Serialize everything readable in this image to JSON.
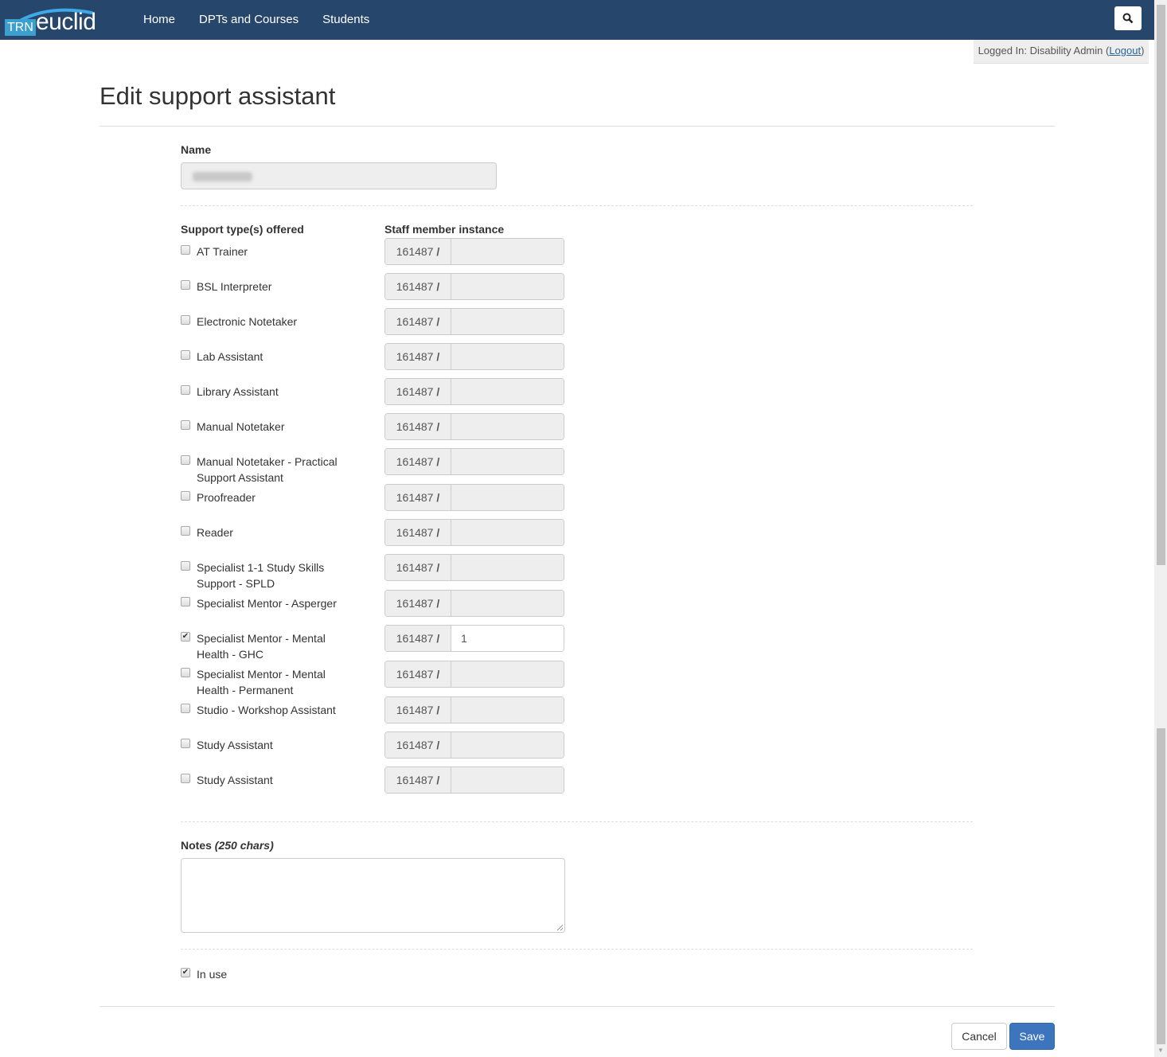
{
  "app": {
    "logo_prefix": "TRN",
    "logo_word": "euclid"
  },
  "nav": {
    "items": [
      {
        "label": "Home"
      },
      {
        "label": "DPTs and Courses"
      },
      {
        "label": "Students"
      }
    ],
    "search_icon": "search-icon"
  },
  "login": {
    "prefix": "Logged In: Disability Admin (",
    "logout_label": "Logout",
    "suffix": ")"
  },
  "page": {
    "title": "Edit support assistant"
  },
  "form": {
    "name_label": "Name",
    "name_value_redacted": true,
    "support_types_label": "Support type(s) offered",
    "staff_instance_label": "Staff member instance",
    "instance_prefix": "161487",
    "instance_separator": "/",
    "support_types": [
      {
        "label": "AT Trainer",
        "checked": false,
        "instance": ""
      },
      {
        "label": "BSL Interpreter",
        "checked": false,
        "instance": ""
      },
      {
        "label": "Electronic Notetaker",
        "checked": false,
        "instance": ""
      },
      {
        "label": "Lab Assistant",
        "checked": false,
        "instance": ""
      },
      {
        "label": "Library Assistant",
        "checked": false,
        "instance": ""
      },
      {
        "label": "Manual Notetaker",
        "checked": false,
        "instance": ""
      },
      {
        "label": "Manual Notetaker - Practical Support Assistant",
        "checked": false,
        "instance": ""
      },
      {
        "label": "Proofreader",
        "checked": false,
        "instance": ""
      },
      {
        "label": "Reader",
        "checked": false,
        "instance": ""
      },
      {
        "label": "Specialist 1-1 Study Skills Support - SPLD",
        "checked": false,
        "instance": ""
      },
      {
        "label": "Specialist Mentor - Asperger",
        "checked": false,
        "instance": ""
      },
      {
        "label": "Specialist Mentor - Mental Health - GHC",
        "checked": true,
        "instance": "1"
      },
      {
        "label": "Specialist Mentor - Mental Health - Permanent",
        "checked": false,
        "instance": ""
      },
      {
        "label": "Studio - Workshop Assistant",
        "checked": false,
        "instance": ""
      },
      {
        "label": "Study Assistant",
        "checked": false,
        "instance": ""
      },
      {
        "label": "Study Assistant",
        "checked": false,
        "instance": ""
      }
    ],
    "notes_label": "Notes",
    "notes_hint": "(250 chars)",
    "notes_value": "",
    "in_use_label": "In use",
    "in_use_checked": true
  },
  "actions": {
    "cancel_label": "Cancel",
    "save_label": "Save"
  },
  "colors": {
    "navbar": "#27466b",
    "primary": "#3c75bd"
  }
}
